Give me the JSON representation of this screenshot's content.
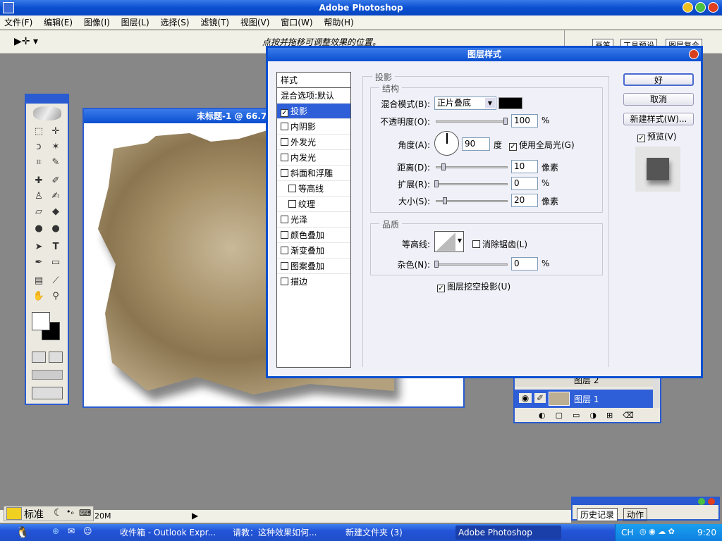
{
  "app": {
    "title": "Adobe Photoshop"
  },
  "menu": [
    "文件(F)",
    "编辑(E)",
    "图像(I)",
    "图层(L)",
    "选择(S)",
    "滤镜(T)",
    "视图(V)",
    "窗口(W)",
    "帮助(H)"
  ],
  "options_bar": {
    "hint": "点按并拖移可调整效果的位置。",
    "tabs": [
      "画笔",
      "工具预设",
      "图层复合"
    ]
  },
  "document": {
    "title": "未标题-1 @ 66.7%"
  },
  "dialog": {
    "title": "图层样式",
    "styles_header": "样式",
    "styles": [
      {
        "label": "混合选项:默认",
        "checkbox": false,
        "selected": false,
        "indent": false
      },
      {
        "label": "投影",
        "checkbox": true,
        "checked": true,
        "selected": true,
        "indent": false
      },
      {
        "label": "内阴影",
        "checkbox": true,
        "checked": false,
        "indent": false
      },
      {
        "label": "外发光",
        "checkbox": true,
        "checked": false,
        "indent": false
      },
      {
        "label": "内发光",
        "checkbox": true,
        "checked": false,
        "indent": false
      },
      {
        "label": "斜面和浮雕",
        "checkbox": true,
        "checked": false,
        "indent": false
      },
      {
        "label": "等高线",
        "checkbox": true,
        "checked": false,
        "indent": true
      },
      {
        "label": "纹理",
        "checkbox": true,
        "checked": false,
        "indent": true
      },
      {
        "label": "光泽",
        "checkbox": true,
        "checked": false,
        "indent": false
      },
      {
        "label": "颜色叠加",
        "checkbox": true,
        "checked": false,
        "indent": false
      },
      {
        "label": "渐变叠加",
        "checkbox": true,
        "checked": false,
        "indent": false
      },
      {
        "label": "图案叠加",
        "checkbox": true,
        "checked": false,
        "indent": false
      },
      {
        "label": "描边",
        "checkbox": true,
        "checked": false,
        "indent": false
      }
    ],
    "drop_shadow": {
      "section": "投影",
      "structure": "结构",
      "blend_mode_label": "混合模式(B):",
      "blend_mode": "正片叠底",
      "shadow_color": "#000000",
      "opacity_label": "不透明度(O):",
      "opacity": "100",
      "angle_label": "角度(A):",
      "angle": "90",
      "angle_unit": "度",
      "global_light": "使用全局光(G)",
      "distance_label": "距离(D):",
      "distance": "10",
      "spread_label": "扩展(R):",
      "spread": "0",
      "size_label": "大小(S):",
      "size": "20",
      "unit_px": "像素",
      "unit_pct": "%",
      "quality": "品质",
      "contour_label": "等高线:",
      "antialias": "消除锯齿(L)",
      "noise_label": "杂色(N):",
      "noise": "0",
      "knockout": "图层挖空投影(U)"
    },
    "buttons": {
      "ok": "好",
      "cancel": "取消",
      "new_style": "新建样式(W)...",
      "preview": "预览(V)"
    }
  },
  "layers": {
    "partial_label": "图层 2",
    "layer1": "图层 1"
  },
  "history": {
    "tabs": [
      "历史记录",
      "动作"
    ]
  },
  "status": {
    "zoom_fragment": "20M"
  },
  "ime": {
    "label": "标准"
  },
  "taskbar": {
    "items": [
      "收件箱 - Outlook Expr...",
      "请教：这种效果如何...",
      "新建文件夹 (3)",
      "Adobe Photoshop"
    ],
    "lang": "CH",
    "time": "9:20"
  }
}
